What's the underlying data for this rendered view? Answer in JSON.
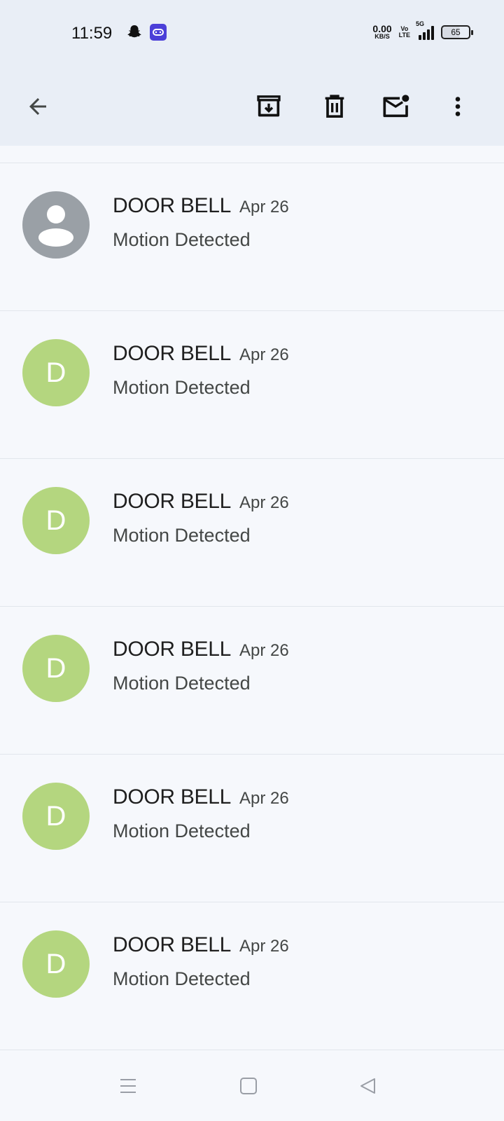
{
  "status_bar": {
    "time": "11:59",
    "net_speed_value": "0.00",
    "net_speed_unit": "KB/S",
    "volte_top": "Vo",
    "volte_bottom": "LTE",
    "network_type": "5G",
    "battery": "65"
  },
  "app_bar": {
    "icons": [
      "back-arrow-icon",
      "archive-icon",
      "delete-icon",
      "mark-unread-icon",
      "more-vert-icon"
    ]
  },
  "messages": [
    {
      "avatar": "",
      "sender": "DOOR BELL",
      "date": "Apr 26",
      "subject": "Motion Detected"
    },
    {
      "avatar": "D",
      "sender": "DOOR BELL",
      "date": "Apr 26",
      "subject": "Motion Detected"
    },
    {
      "avatar": "D",
      "sender": "DOOR BELL",
      "date": "Apr 26",
      "subject": "Motion Detected"
    },
    {
      "avatar": "D",
      "sender": "DOOR BELL",
      "date": "Apr 26",
      "subject": "Motion Detected"
    },
    {
      "avatar": "D",
      "sender": "DOOR BELL",
      "date": "Apr 26",
      "subject": "Motion Detected"
    },
    {
      "avatar": "D",
      "sender": "DOOR BELL",
      "date": "Apr 26",
      "subject": "Motion Detected"
    }
  ],
  "colors": {
    "app_bar_bg": "#e9eef6",
    "list_bg": "#f6f8fc",
    "avatar_letter_bg": "#b4d67f",
    "avatar_generic_bg": "#9aa0a6"
  }
}
